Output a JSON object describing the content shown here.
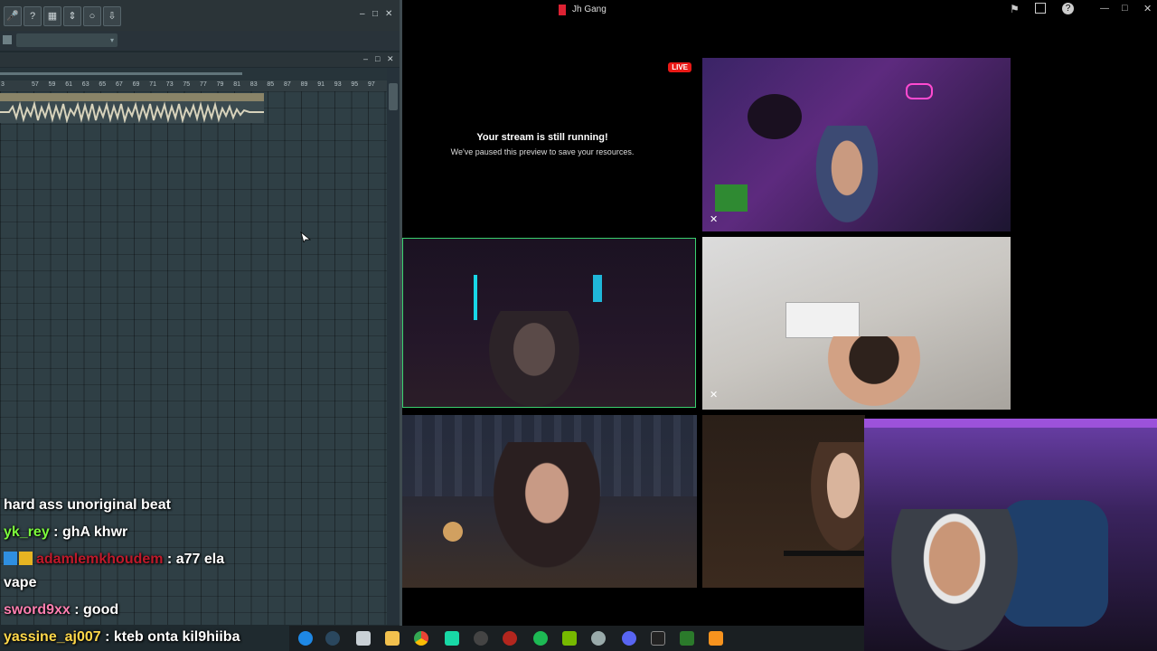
{
  "window": {
    "title": "Jh Gang",
    "min_label": "—",
    "max_label": "□",
    "close_label": "✕"
  },
  "fl_studio": {
    "toolbar_icons": [
      "microphone-icon",
      "help-icon",
      "save-icon",
      "mixer-icon",
      "chat-icon",
      "download-icon"
    ],
    "ruler_ticks": [
      "3",
      "57",
      "59",
      "61",
      "63",
      "65",
      "67",
      "69",
      "71",
      "73",
      "75",
      "77",
      "79",
      "81",
      "83",
      "85",
      "87",
      "89",
      "91",
      "93",
      "95",
      "97"
    ],
    "win_min": "–",
    "win_max": "□",
    "win_close": "✕",
    "combo_arrow": "▾"
  },
  "stream": {
    "live_badge": "LIVE",
    "paused_title": "Your stream is still running!",
    "paused_subtitle": "We've paused this preview to save your resources."
  },
  "chat": {
    "messages": [
      {
        "user": "",
        "text": "hard ass unoriginal beat",
        "color": "#ffffff"
      },
      {
        "user": "yk_rey",
        "text": " : ghA khwr",
        "color": "#7cfc3c"
      },
      {
        "user": "adamlemkhoudem",
        "text": " : a77 ela",
        "color": "#c0192a"
      },
      {
        "user": "",
        "text": "vape",
        "color": "#ffffff"
      },
      {
        "user": "sword9xx",
        "text": " : good",
        "color": "#ff7fb0"
      },
      {
        "user": "yassine_aj007",
        "text": " : kteb onta kil9hiiba",
        "color": "#ffd84a"
      }
    ]
  },
  "colors": {
    "live_red": "#e91916",
    "speaking_border": "#3ad16f",
    "fl_bg": "#2f3f45"
  }
}
